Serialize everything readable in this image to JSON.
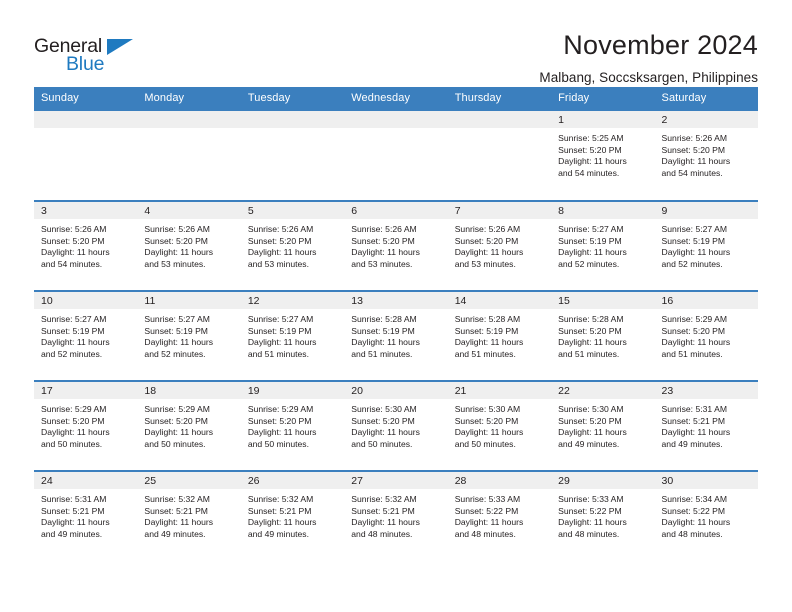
{
  "brand": {
    "name_top": "General",
    "name_bottom": "Blue",
    "accent_color": "#1f7ac0",
    "triangle_icon": "triangle-icon"
  },
  "header": {
    "title": "November 2024",
    "subtitle": "Malbang, Soccsksargen, Philippines"
  },
  "colors": {
    "header_row_bg": "#3b7fbe",
    "daynum_band_bg": "#efefef",
    "text": "#231f20",
    "cell_bg": "#ffffff"
  },
  "weekdays": [
    "Sunday",
    "Monday",
    "Tuesday",
    "Wednesday",
    "Thursday",
    "Friday",
    "Saturday"
  ],
  "weeks": [
    [
      {
        "day": "",
        "empty": true,
        "sunrise": "",
        "sunset": "",
        "daylight_line1": "",
        "daylight_line2": ""
      },
      {
        "day": "",
        "empty": true,
        "sunrise": "",
        "sunset": "",
        "daylight_line1": "",
        "daylight_line2": ""
      },
      {
        "day": "",
        "empty": true,
        "sunrise": "",
        "sunset": "",
        "daylight_line1": "",
        "daylight_line2": ""
      },
      {
        "day": "",
        "empty": true,
        "sunrise": "",
        "sunset": "",
        "daylight_line1": "",
        "daylight_line2": ""
      },
      {
        "day": "",
        "empty": true,
        "sunrise": "",
        "sunset": "",
        "daylight_line1": "",
        "daylight_line2": ""
      },
      {
        "day": "1",
        "empty": false,
        "sunrise": "Sunrise: 5:25 AM",
        "sunset": "Sunset: 5:20 PM",
        "daylight_line1": "Daylight: 11 hours",
        "daylight_line2": "and 54 minutes."
      },
      {
        "day": "2",
        "empty": false,
        "sunrise": "Sunrise: 5:26 AM",
        "sunset": "Sunset: 5:20 PM",
        "daylight_line1": "Daylight: 11 hours",
        "daylight_line2": "and 54 minutes."
      }
    ],
    [
      {
        "day": "3",
        "empty": false,
        "sunrise": "Sunrise: 5:26 AM",
        "sunset": "Sunset: 5:20 PM",
        "daylight_line1": "Daylight: 11 hours",
        "daylight_line2": "and 54 minutes."
      },
      {
        "day": "4",
        "empty": false,
        "sunrise": "Sunrise: 5:26 AM",
        "sunset": "Sunset: 5:20 PM",
        "daylight_line1": "Daylight: 11 hours",
        "daylight_line2": "and 53 minutes."
      },
      {
        "day": "5",
        "empty": false,
        "sunrise": "Sunrise: 5:26 AM",
        "sunset": "Sunset: 5:20 PM",
        "daylight_line1": "Daylight: 11 hours",
        "daylight_line2": "and 53 minutes."
      },
      {
        "day": "6",
        "empty": false,
        "sunrise": "Sunrise: 5:26 AM",
        "sunset": "Sunset: 5:20 PM",
        "daylight_line1": "Daylight: 11 hours",
        "daylight_line2": "and 53 minutes."
      },
      {
        "day": "7",
        "empty": false,
        "sunrise": "Sunrise: 5:26 AM",
        "sunset": "Sunset: 5:20 PM",
        "daylight_line1": "Daylight: 11 hours",
        "daylight_line2": "and 53 minutes."
      },
      {
        "day": "8",
        "empty": false,
        "sunrise": "Sunrise: 5:27 AM",
        "sunset": "Sunset: 5:19 PM",
        "daylight_line1": "Daylight: 11 hours",
        "daylight_line2": "and 52 minutes."
      },
      {
        "day": "9",
        "empty": false,
        "sunrise": "Sunrise: 5:27 AM",
        "sunset": "Sunset: 5:19 PM",
        "daylight_line1": "Daylight: 11 hours",
        "daylight_line2": "and 52 minutes."
      }
    ],
    [
      {
        "day": "10",
        "empty": false,
        "sunrise": "Sunrise: 5:27 AM",
        "sunset": "Sunset: 5:19 PM",
        "daylight_line1": "Daylight: 11 hours",
        "daylight_line2": "and 52 minutes."
      },
      {
        "day": "11",
        "empty": false,
        "sunrise": "Sunrise: 5:27 AM",
        "sunset": "Sunset: 5:19 PM",
        "daylight_line1": "Daylight: 11 hours",
        "daylight_line2": "and 52 minutes."
      },
      {
        "day": "12",
        "empty": false,
        "sunrise": "Sunrise: 5:27 AM",
        "sunset": "Sunset: 5:19 PM",
        "daylight_line1": "Daylight: 11 hours",
        "daylight_line2": "and 51 minutes."
      },
      {
        "day": "13",
        "empty": false,
        "sunrise": "Sunrise: 5:28 AM",
        "sunset": "Sunset: 5:19 PM",
        "daylight_line1": "Daylight: 11 hours",
        "daylight_line2": "and 51 minutes."
      },
      {
        "day": "14",
        "empty": false,
        "sunrise": "Sunrise: 5:28 AM",
        "sunset": "Sunset: 5:19 PM",
        "daylight_line1": "Daylight: 11 hours",
        "daylight_line2": "and 51 minutes."
      },
      {
        "day": "15",
        "empty": false,
        "sunrise": "Sunrise: 5:28 AM",
        "sunset": "Sunset: 5:20 PM",
        "daylight_line1": "Daylight: 11 hours",
        "daylight_line2": "and 51 minutes."
      },
      {
        "day": "16",
        "empty": false,
        "sunrise": "Sunrise: 5:29 AM",
        "sunset": "Sunset: 5:20 PM",
        "daylight_line1": "Daylight: 11 hours",
        "daylight_line2": "and 51 minutes."
      }
    ],
    [
      {
        "day": "17",
        "empty": false,
        "sunrise": "Sunrise: 5:29 AM",
        "sunset": "Sunset: 5:20 PM",
        "daylight_line1": "Daylight: 11 hours",
        "daylight_line2": "and 50 minutes."
      },
      {
        "day": "18",
        "empty": false,
        "sunrise": "Sunrise: 5:29 AM",
        "sunset": "Sunset: 5:20 PM",
        "daylight_line1": "Daylight: 11 hours",
        "daylight_line2": "and 50 minutes."
      },
      {
        "day": "19",
        "empty": false,
        "sunrise": "Sunrise: 5:29 AM",
        "sunset": "Sunset: 5:20 PM",
        "daylight_line1": "Daylight: 11 hours",
        "daylight_line2": "and 50 minutes."
      },
      {
        "day": "20",
        "empty": false,
        "sunrise": "Sunrise: 5:30 AM",
        "sunset": "Sunset: 5:20 PM",
        "daylight_line1": "Daylight: 11 hours",
        "daylight_line2": "and 50 minutes."
      },
      {
        "day": "21",
        "empty": false,
        "sunrise": "Sunrise: 5:30 AM",
        "sunset": "Sunset: 5:20 PM",
        "daylight_line1": "Daylight: 11 hours",
        "daylight_line2": "and 50 minutes."
      },
      {
        "day": "22",
        "empty": false,
        "sunrise": "Sunrise: 5:30 AM",
        "sunset": "Sunset: 5:20 PM",
        "daylight_line1": "Daylight: 11 hours",
        "daylight_line2": "and 49 minutes."
      },
      {
        "day": "23",
        "empty": false,
        "sunrise": "Sunrise: 5:31 AM",
        "sunset": "Sunset: 5:21 PM",
        "daylight_line1": "Daylight: 11 hours",
        "daylight_line2": "and 49 minutes."
      }
    ],
    [
      {
        "day": "24",
        "empty": false,
        "sunrise": "Sunrise: 5:31 AM",
        "sunset": "Sunset: 5:21 PM",
        "daylight_line1": "Daylight: 11 hours",
        "daylight_line2": "and 49 minutes."
      },
      {
        "day": "25",
        "empty": false,
        "sunrise": "Sunrise: 5:32 AM",
        "sunset": "Sunset: 5:21 PM",
        "daylight_line1": "Daylight: 11 hours",
        "daylight_line2": "and 49 minutes."
      },
      {
        "day": "26",
        "empty": false,
        "sunrise": "Sunrise: 5:32 AM",
        "sunset": "Sunset: 5:21 PM",
        "daylight_line1": "Daylight: 11 hours",
        "daylight_line2": "and 49 minutes."
      },
      {
        "day": "27",
        "empty": false,
        "sunrise": "Sunrise: 5:32 AM",
        "sunset": "Sunset: 5:21 PM",
        "daylight_line1": "Daylight: 11 hours",
        "daylight_line2": "and 48 minutes."
      },
      {
        "day": "28",
        "empty": false,
        "sunrise": "Sunrise: 5:33 AM",
        "sunset": "Sunset: 5:22 PM",
        "daylight_line1": "Daylight: 11 hours",
        "daylight_line2": "and 48 minutes."
      },
      {
        "day": "29",
        "empty": false,
        "sunrise": "Sunrise: 5:33 AM",
        "sunset": "Sunset: 5:22 PM",
        "daylight_line1": "Daylight: 11 hours",
        "daylight_line2": "and 48 minutes."
      },
      {
        "day": "30",
        "empty": false,
        "sunrise": "Sunrise: 5:34 AM",
        "sunset": "Sunset: 5:22 PM",
        "daylight_line1": "Daylight: 11 hours",
        "daylight_line2": "and 48 minutes."
      }
    ]
  ]
}
